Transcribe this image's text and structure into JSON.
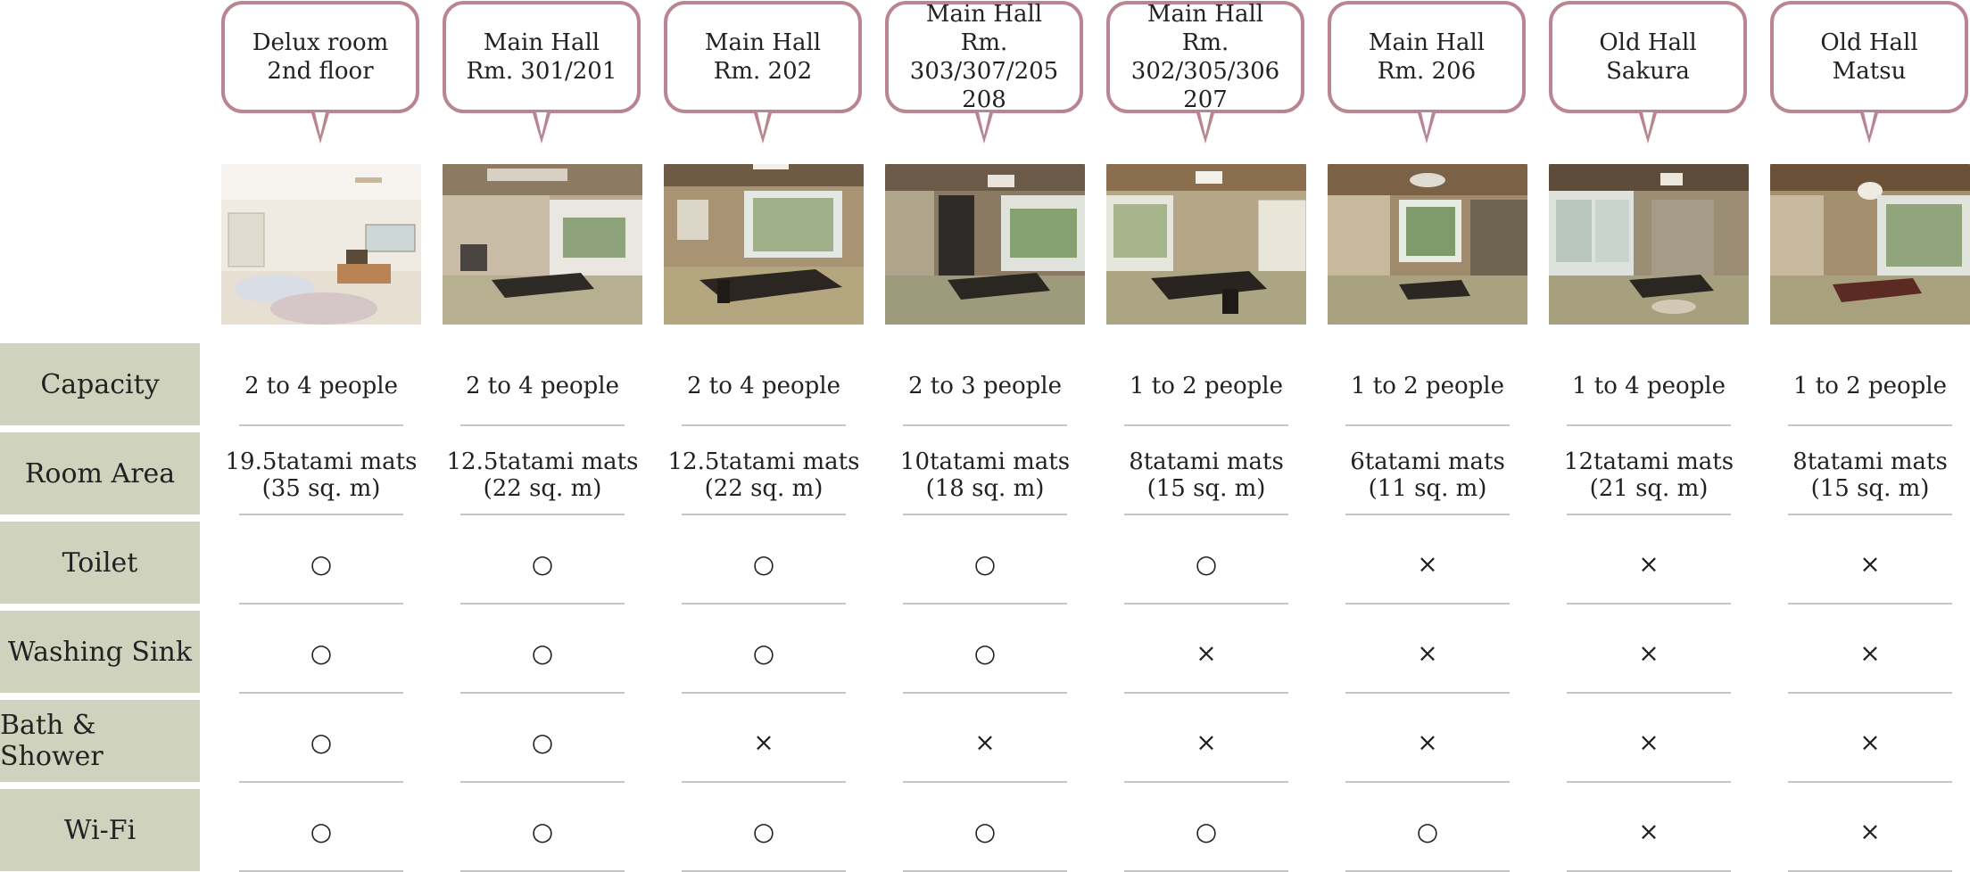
{
  "rows": {
    "capacity": "Capacity",
    "area": "Room Area",
    "toilet": "Toilet",
    "sink": "Washing Sink",
    "bath": "Bath & Shower",
    "wifi": "Wi-Fi"
  },
  "rooms": [
    {
      "title": "Delux room\n2nd floor",
      "capacity": "2 to 4 people",
      "area": "19.5tatami mats\n(35 sq. m)",
      "toilet": "○",
      "sink": "○",
      "bath": "○",
      "wifi": "○"
    },
    {
      "title": "Main Hall\nRm. 301/201",
      "capacity": "2 to 4 people",
      "area": "12.5tatami mats\n(22 sq. m)",
      "toilet": "○",
      "sink": "○",
      "bath": "○",
      "wifi": "○"
    },
    {
      "title": "Main Hall\nRm. 202",
      "capacity": "2 to 4 people",
      "area": "12.5tatami mats\n(22 sq. m)",
      "toilet": "○",
      "sink": "○",
      "bath": "×",
      "wifi": "○"
    },
    {
      "title": "Main Hall\nRm. 303/307/205\n208",
      "capacity": "2 to 3 people",
      "area": "10tatami mats\n(18 sq. m)",
      "toilet": "○",
      "sink": "○",
      "bath": "×",
      "wifi": "○"
    },
    {
      "title": "Main Hall\nRm. 302/305/306\n207",
      "capacity": "1 to 2 people",
      "area": "8tatami mats\n(15 sq. m)",
      "toilet": "○",
      "sink": "×",
      "bath": "×",
      "wifi": "○"
    },
    {
      "title": "Main Hall\nRm. 206",
      "capacity": "1 to 2 people",
      "area": "6tatami mats\n(11 sq. m)",
      "toilet": "×",
      "sink": "×",
      "bath": "×",
      "wifi": "○"
    },
    {
      "title": "Old Hall\nSakura",
      "capacity": "1 to 4 people",
      "area": "12tatami mats\n(21 sq. m)",
      "toilet": "×",
      "sink": "×",
      "bath": "×",
      "wifi": "×"
    },
    {
      "title": "Old Hall\nMatsu",
      "capacity": "1 to 2 people",
      "area": "8tatami mats\n(15 sq. m)",
      "toilet": "×",
      "sink": "×",
      "bath": "×",
      "wifi": "×"
    }
  ],
  "colors": {
    "bubble_border": "#b88590",
    "label_bg": "#cfd2bc",
    "divider": "#c4c4c4"
  }
}
